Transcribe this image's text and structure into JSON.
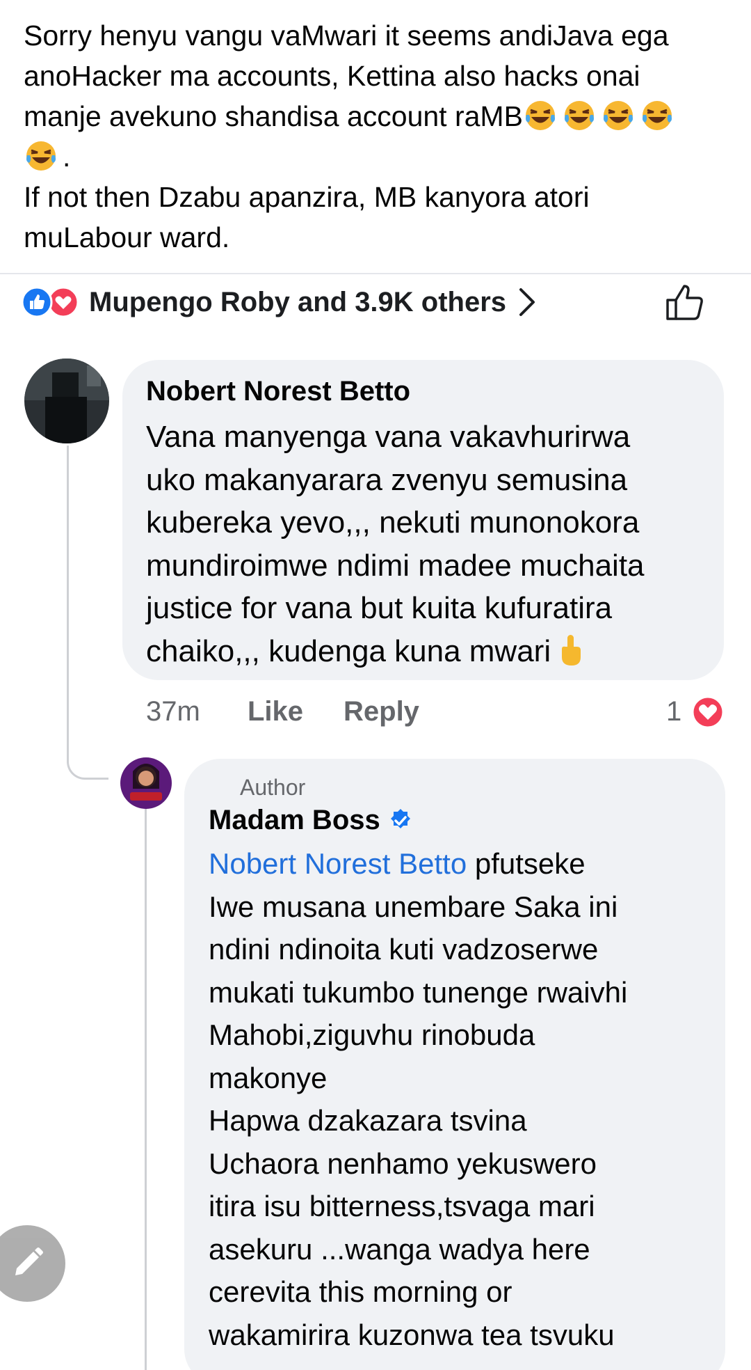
{
  "post": {
    "lines": [
      "Sorry henyu vangu vaMwari it seems andiJava ega",
      "anoHacker ma accounts, Kettina also hacks onai",
      "manje avekuno shandisa account raMB",
      ".",
      "If not then Dzabu apanzira, MB kanyora atori",
      "muLabour ward."
    ],
    "emoji_name": "rolling-on-floor-laughing"
  },
  "reactions": {
    "summary": "Mupengo Roby and 3.9K others",
    "icons": [
      "like-icon",
      "love-icon"
    ]
  },
  "comments": [
    {
      "author": "Nobert Norest Betto",
      "lines": [
        "Vana manyenga vana vakavhurirwa",
        "uko makanyarara zvenyu semusina",
        "kubereka yevo,,, nekuti munonokora",
        "mundiroimwe ndimi madee muchaita",
        "justice for vana but kuita kufuratira",
        "chaiko,,, kudenga kuna mwari"
      ],
      "time": "37m",
      "like_label": "Like",
      "reply_label": "Reply",
      "reaction_count": "1"
    }
  ],
  "reply": {
    "badge": "Author",
    "author": "Madam Boss",
    "mention": "Nobert Norest Betto",
    "first_line_rest": " pfutseke",
    "lines": [
      "Iwe musana unembare Saka ini",
      "ndini ndinoita kuti vadzoserwe",
      "mukati tukumbo tunenge rwaivhi",
      "Mahobi,ziguvhu rinobuda",
      "makonye",
      "Hapwa dzakazara tsvina",
      "Uchaora nenhamo yekuswero",
      "itira isu bitterness,tsvaga mari",
      "asekuru ...wanga wadya here",
      "cerevita this morning or",
      "wakamirira kuzonwa tea tsvuku"
    ]
  },
  "colors": {
    "bubble": "#f0f2f5",
    "link": "#216fdb",
    "meta": "#65676b",
    "like_blue": "#1877f2",
    "love_red": "#f33e58"
  }
}
